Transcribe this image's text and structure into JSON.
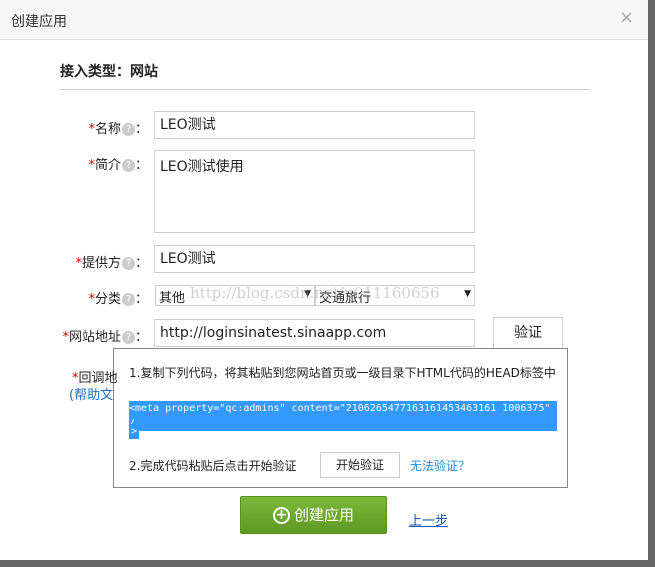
{
  "dialog": {
    "title": "创建应用",
    "close": "×"
  },
  "access_type": "接入类型：网站",
  "form": {
    "star": "*",
    "help": "?",
    "colon": "：",
    "name": {
      "label": "名称",
      "value": "LEO测试"
    },
    "intro": {
      "label": "简介",
      "value": "LEO测试使用"
    },
    "provider": {
      "label": "提供方",
      "value": "LEO测试"
    },
    "category": {
      "label": "分类",
      "value1": "其他",
      "value2": "交通旅行"
    },
    "url": {
      "label": "网站地址",
      "value": "http://loginsinatest.sinaapp.com",
      "verify": "验证"
    },
    "callback": {
      "label": "回调地",
      "help_link": "(帮助文"
    }
  },
  "popup": {
    "step1": "1.复制下列代码，将其粘贴到您网站首页或一级目录下HTML代码的HEAD标签中",
    "code_line1": "<meta property=\"qc:admins\" content=\"2106265477163161453463161 1006375\" /",
    "code_line2": ">",
    "step2": "2.完成代码粘贴后点击开始验证",
    "start": "开始验证",
    "cant": "无法验证？"
  },
  "watermark": "http://blog.csdn.net/u011160656",
  "actions": {
    "create": "创建应用",
    "prev": "上一步"
  }
}
